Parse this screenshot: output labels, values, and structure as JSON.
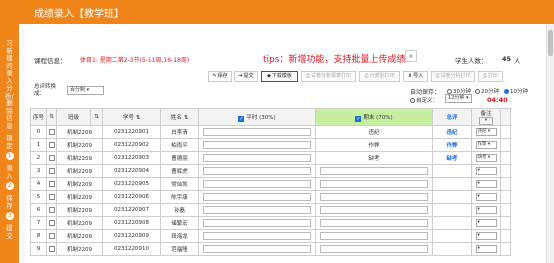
{
  "window": {
    "title": "成绩录入【教学班】"
  },
  "sidebar": {
    "items": [
      {
        "text": "习新建的录入分析/删除信息",
        "num": ""
      },
      {
        "text": "锁定",
        "num": "1"
      },
      {
        "text": "录入",
        "num": "2"
      },
      {
        "text": "保存",
        "num": "3"
      },
      {
        "text": "提交",
        "num": ""
      }
    ]
  },
  "info": {
    "course_label": "课程信息：",
    "course_value": "体育1: 星期二第2-3节(5-11周,16-18周)",
    "tips": "tips：新增功能，支持批量上传成绩",
    "student_count_label": "学生人数：",
    "student_count": "45",
    "student_count_unit": "人"
  },
  "toolbar": {
    "save": "保存",
    "submit": "提交",
    "download": "下载模板",
    "analysis_print": "试卷分析报表打印",
    "sort_print": "分类别打印",
    "import": "导入",
    "paper_analysis": "试卷分析打印",
    "print": "打印"
  },
  "filter": {
    "label": "总评转换成：",
    "select_value": "百分制"
  },
  "autosave": {
    "label": "自动保存：",
    "options": [
      "30分钟",
      "20分钟",
      "10分钟",
      "自定义："
    ],
    "selected": "10分钟",
    "custom_value": "12分钟",
    "timer": "04:40"
  },
  "table": {
    "headers": {
      "seq": "序号",
      "class": "班级",
      "student_id": "学号",
      "name": "姓名",
      "regular": "平时 (30%)",
      "final": "期末 (70%)",
      "total": "总评",
      "remark": "备注"
    },
    "sort_glyph": "⇅",
    "rows": [
      {
        "seq": "0",
        "class": "机制2209",
        "id": "0231220901",
        "name": "白李清",
        "final": "违纪",
        "total": "违纪",
        "remark": "违纪"
      },
      {
        "seq": "1",
        "class": "机制2209",
        "id": "0231220902",
        "name": "柏雨平",
        "final": "作弊",
        "total": "作弊",
        "remark": "作弊"
      },
      {
        "seq": "2",
        "class": "机制2209",
        "id": "0231220903",
        "name": "曹德丽",
        "final": "缺考",
        "total": "缺考",
        "remark": "缺考"
      },
      {
        "seq": "3",
        "class": "机制2209",
        "id": "0231220904",
        "name": "曹辉虎",
        "final": "",
        "total": "",
        "remark": ""
      },
      {
        "seq": "4",
        "class": "机制2209",
        "id": "0231220905",
        "name": "常灿凯",
        "final": "",
        "total": "",
        "remark": ""
      },
      {
        "seq": "5",
        "class": "机制2209",
        "id": "0231220906",
        "name": "陈宇康",
        "final": "",
        "total": "",
        "remark": ""
      },
      {
        "seq": "6",
        "class": "机制2209",
        "id": "0231220907",
        "name": "孙磊",
        "final": "",
        "total": "",
        "remark": ""
      },
      {
        "seq": "7",
        "class": "机制2209",
        "id": "0231220908",
        "name": "储繁宏",
        "final": "",
        "total": "",
        "remark": ""
      },
      {
        "seq": "8",
        "class": "机制2209",
        "id": "0231220909",
        "name": "段海龙",
        "final": "",
        "total": "",
        "remark": ""
      },
      {
        "seq": "9",
        "class": "机制2209",
        "id": "0231220910",
        "name": "范福隆",
        "final": "",
        "total": "",
        "remark": ""
      }
    ]
  },
  "colors": {
    "accent": "#f08519",
    "highlight": "#e0141e",
    "final_header": "#c6f0a0",
    "link": "#1e6fd9"
  }
}
